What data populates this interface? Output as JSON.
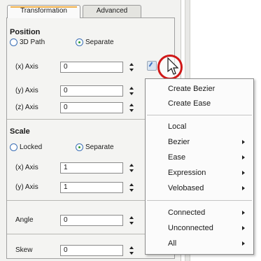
{
  "tabs": [
    {
      "label": "Transformation",
      "active": true
    },
    {
      "label": "Advanced",
      "active": false
    }
  ],
  "position": {
    "title": "Position",
    "options": [
      {
        "label": "3D Path",
        "selected": false
      },
      {
        "label": "Separate",
        "selected": true
      }
    ],
    "rows": [
      {
        "label": "(x) Axis",
        "value": "0"
      },
      {
        "label": "(y) Axis",
        "value": "0"
      },
      {
        "label": "(z) Axis",
        "value": "0"
      }
    ]
  },
  "scale": {
    "title": "Scale",
    "options": [
      {
        "label": "Locked",
        "selected": false
      },
      {
        "label": "Separate",
        "selected": true
      }
    ],
    "rows": [
      {
        "label": "(x) Axis",
        "value": "1"
      },
      {
        "label": "(y) Axis",
        "value": "1"
      }
    ]
  },
  "angle": {
    "label": "Angle",
    "value": "0"
  },
  "skew": {
    "label": "Skew",
    "value": "0"
  },
  "context_menu": {
    "groups": [
      [
        {
          "label": "Create Bezier",
          "submenu": false
        },
        {
          "label": "Create Ease",
          "submenu": false
        }
      ],
      [
        {
          "label": "Local",
          "submenu": false
        },
        {
          "label": "Bezier",
          "submenu": true
        },
        {
          "label": "Ease",
          "submenu": true
        },
        {
          "label": "Expression",
          "submenu": true
        },
        {
          "label": "Velobased",
          "submenu": true
        }
      ],
      [
        {
          "label": "Connected",
          "submenu": true
        },
        {
          "label": "Unconnected",
          "submenu": true
        },
        {
          "label": "All",
          "submenu": true
        }
      ]
    ]
  },
  "colors": {
    "highlight_circle": "#d01818",
    "radio_border": "#3b6fb6",
    "radio_dot": "#2c9a2c",
    "tab_accent": "#f0b048"
  }
}
